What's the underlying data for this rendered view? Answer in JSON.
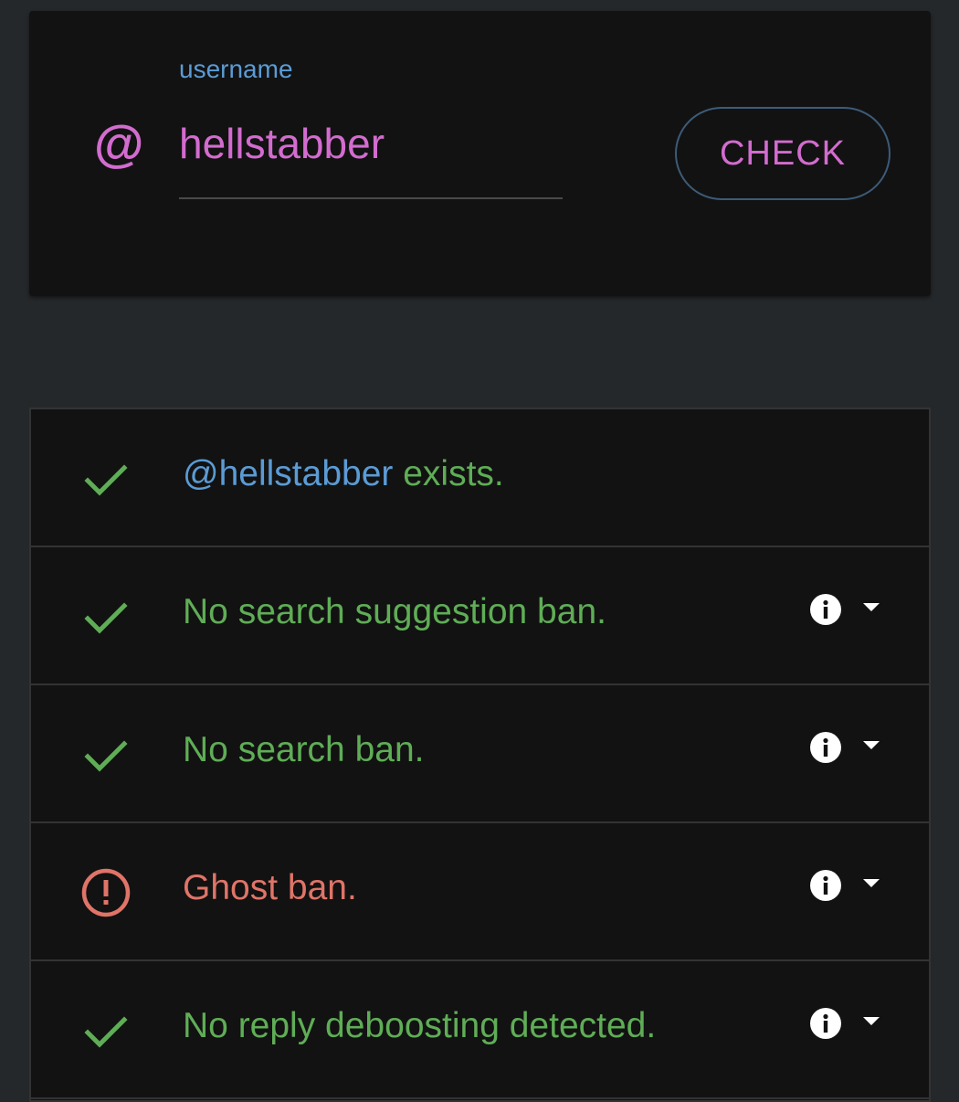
{
  "search": {
    "at_symbol": "@",
    "label": "username",
    "value": "hellstabber",
    "button_label": "CHECK"
  },
  "results": [
    {
      "status": "ok",
      "icon": "check-icon",
      "mention": "@hellstabber",
      "text": " exists.",
      "has_info": false
    },
    {
      "status": "ok",
      "icon": "check-icon",
      "text": "No search suggestion ban.",
      "has_info": true
    },
    {
      "status": "ok",
      "icon": "check-icon",
      "text": "No search ban.",
      "has_info": true
    },
    {
      "status": "bad",
      "icon": "alert-circle-icon",
      "text": "Ghost ban.",
      "has_info": true
    },
    {
      "status": "ok",
      "icon": "check-icon",
      "text": "No reply deboosting detected.",
      "has_info": true
    }
  ],
  "colors": {
    "background": "#25282b",
    "card": "#121212",
    "accent_pink": "#d36ccf",
    "accent_blue": "#5b9bd5",
    "ok_green": "#5fad56",
    "error_red": "#e07468"
  }
}
